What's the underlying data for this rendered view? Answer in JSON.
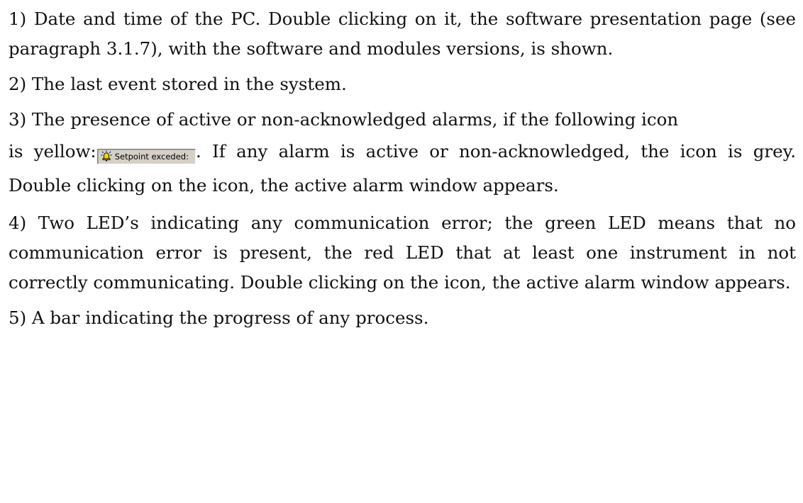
{
  "paragraphs": [
    {
      "text": "1) Date and time of the PC. Double clicking on it, the software presentation page (see paragraph 3.1.7), with the software and modules versions, is shown."
    },
    {
      "text": "2) The last event stored in the system."
    },
    {
      "line1": "3) The presence of active or non-acknowledged alarms, if the following icon",
      "before_icon": "is yellow:",
      "icon_label": "Setpoint exceded:",
      "icon": "alarm-bell-icon",
      "icon_color": "#ffd200",
      "after_icon": ". If any alarm is active or non-acknowledged, the icon is grey. Double clicking on the icon, the active alarm window appears."
    },
    {
      "text": "4) Two LED’s indicating any communication error; the green LED means that no communication error is present, the red LED that at least one instrument in not correctly communicating. Double clicking on the icon, the active alarm window appears."
    },
    {
      "text": "5) A bar indicating the progress of any process."
    }
  ]
}
